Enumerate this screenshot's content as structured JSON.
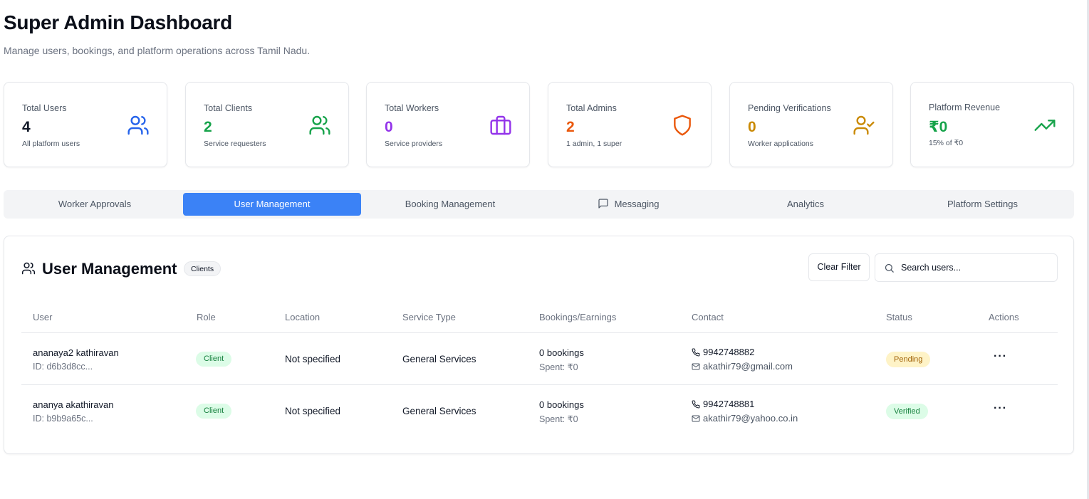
{
  "header": {
    "title": "Super Admin Dashboard",
    "subtitle": "Manage users, bookings, and platform operations across Tamil Nadu."
  },
  "stats": [
    {
      "label": "Total Users",
      "value": "4",
      "sub": "All platform users",
      "color": "#2563eb",
      "icon": "users-icon"
    },
    {
      "label": "Total Clients",
      "value": "2",
      "sub": "Service requesters",
      "color": "#16a34a",
      "icon": "users-icon"
    },
    {
      "label": "Total Workers",
      "value": "0",
      "sub": "Service providers",
      "color": "#9333ea",
      "icon": "briefcase-icon"
    },
    {
      "label": "Total Admins",
      "value": "2",
      "sub": "1 admin, 1 super",
      "color": "#ea580c",
      "icon": "shield-icon"
    },
    {
      "label": "Pending Verifications",
      "value": "0",
      "sub": "Worker applications",
      "color": "#ca8a04",
      "icon": "user-check-icon"
    },
    {
      "label": "Platform Revenue",
      "value": "₹0",
      "sub": "15% of ₹0",
      "color": "#16a34a",
      "icon": "trending-up-icon"
    }
  ],
  "tabs": [
    {
      "label": "Worker Approvals",
      "active": false
    },
    {
      "label": "User Management",
      "active": true
    },
    {
      "label": "Booking Management",
      "active": false
    },
    {
      "label": "Messaging",
      "active": false,
      "icon": "message-square-icon"
    },
    {
      "label": "Analytics",
      "active": false
    },
    {
      "label": "Platform Settings",
      "active": false
    }
  ],
  "panel": {
    "title": "User Management",
    "filter_badge": "Clients",
    "clear_filter_label": "Clear Filter",
    "search_placeholder": "Search users...",
    "columns": [
      "User",
      "Role",
      "Location",
      "Service Type",
      "Bookings/Earnings",
      "Contact",
      "Status",
      "Actions"
    ],
    "rows": [
      {
        "name": "ananaya2 kathiravan",
        "id": "ID: d6b3d8cc...",
        "role": "Client",
        "location": "Not specified",
        "service_type": "General Services",
        "bookings": "0 bookings",
        "spent": "Spent: ₹0",
        "phone": "9942748882",
        "email": "akathir79@gmail.com",
        "status": "Pending",
        "actions": "···"
      },
      {
        "name": "ananya akathiravan",
        "id": "ID: b9b9a65c...",
        "role": "Client",
        "location": "Not specified",
        "service_type": "General Services",
        "bookings": "0 bookings",
        "spent": "Spent: ₹0",
        "phone": "9942748881",
        "email": "akathir79@yahoo.co.in",
        "status": "Verified",
        "actions": "···"
      }
    ]
  }
}
